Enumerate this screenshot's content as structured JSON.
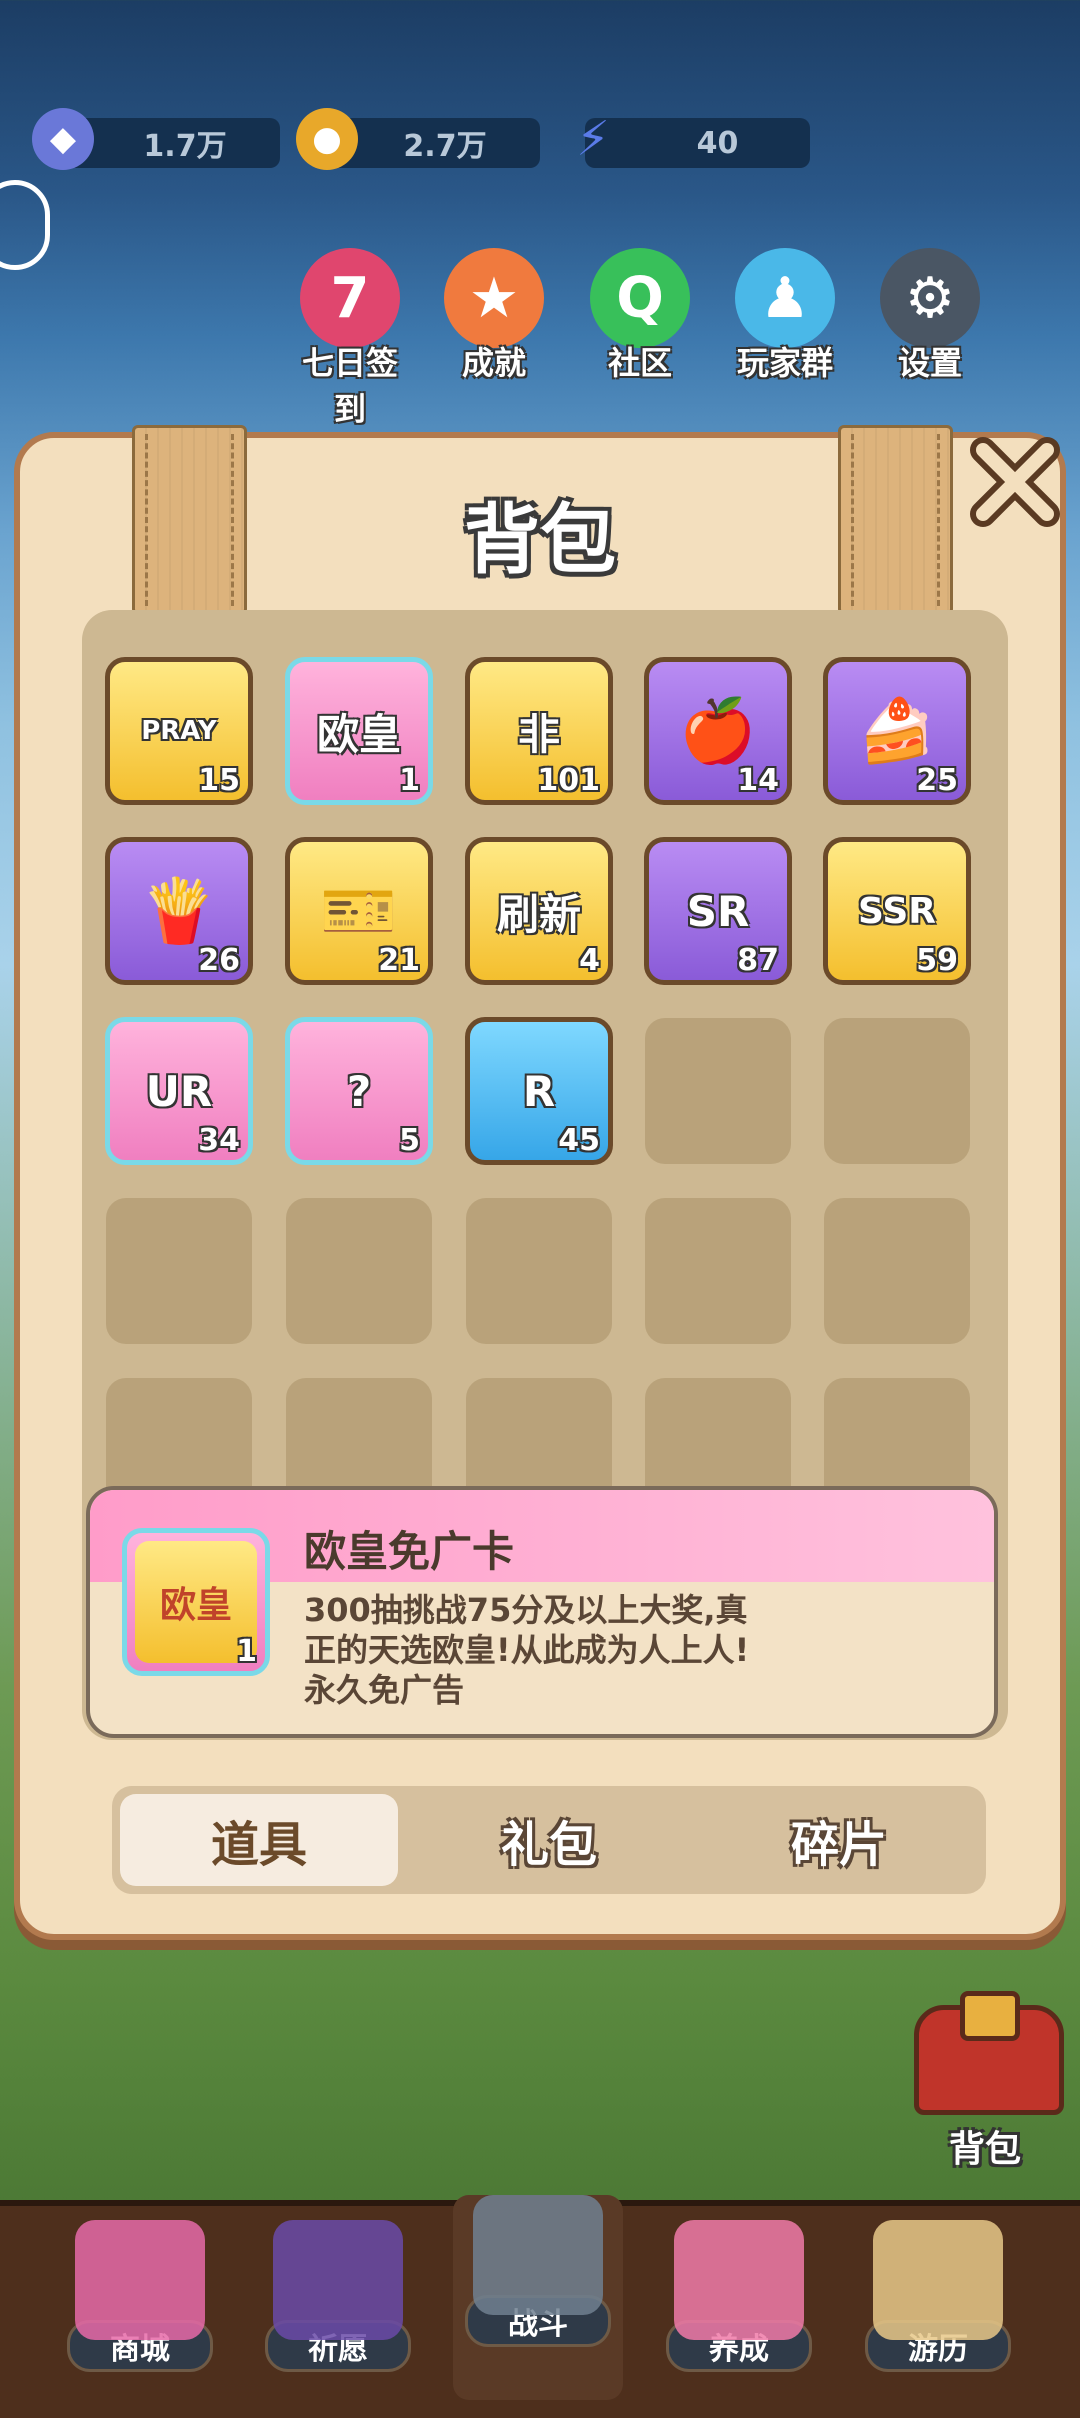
{
  "currency": {
    "gems": "1.7万",
    "coins": "2.7万",
    "energy": "40"
  },
  "top_menu": [
    {
      "label": "七日签到",
      "icon": "seven-day-icon",
      "glyph": "7",
      "color": "#e0466e"
    },
    {
      "label": "成就",
      "icon": "trophy-icon",
      "glyph": "★",
      "color": "#f07a3e"
    },
    {
      "label": "社区",
      "icon": "community-icon",
      "glyph": "Q",
      "color": "#38c05a"
    },
    {
      "label": "玩家群",
      "icon": "qq-penguin-icon",
      "glyph": "♟",
      "color": "#4ab8e8"
    },
    {
      "label": "设置",
      "icon": "gear-icon",
      "glyph": "⚙",
      "color": "#4a5664"
    }
  ],
  "panel": {
    "title": "背包"
  },
  "items": [
    {
      "icon": "pray-ticket-icon",
      "text": "PRAY",
      "count": "15",
      "frame": "gold"
    },
    {
      "icon": "ouhuang-card-icon",
      "text": "欧皇",
      "count": "1",
      "frame": "pink"
    },
    {
      "icon": "feiqiu-card-icon",
      "text": "非",
      "count": "101",
      "frame": "gold"
    },
    {
      "icon": "apple-icon",
      "text": "",
      "count": "14",
      "frame": "purple"
    },
    {
      "icon": "cake-icon",
      "text": "",
      "count": "25",
      "frame": "purple"
    },
    {
      "icon": "chips-icon",
      "text": "",
      "count": "26",
      "frame": "purple"
    },
    {
      "icon": "ghost-ticket-icon",
      "text": "",
      "count": "21",
      "frame": "gold"
    },
    {
      "icon": "refresh-card-icon",
      "text": "刷新",
      "count": "4",
      "frame": "gold"
    },
    {
      "icon": "sr-puzzle-icon",
      "text": "SR",
      "count": "87",
      "frame": "purple"
    },
    {
      "icon": "ssr-puzzle-icon",
      "text": "SSR",
      "count": "59",
      "frame": "gold"
    },
    {
      "icon": "ur-puzzle-icon",
      "text": "UR",
      "count": "34",
      "frame": "pink"
    },
    {
      "icon": "mystery-bag-icon",
      "text": "?",
      "count": "5",
      "frame": "pink"
    },
    {
      "icon": "r-puzzle-icon",
      "text": "R",
      "count": "45",
      "frame": "blue"
    }
  ],
  "detail": {
    "name": "欧皇免广卡",
    "desc": "300抽挑战75分及以上大奖,真正的天选欧皇!从此成为人上人!永久免广告",
    "icon_text": "欧皇",
    "count": "1"
  },
  "tabs": [
    {
      "label": "道具",
      "active": true
    },
    {
      "label": "礼包",
      "active": false
    },
    {
      "label": "碎片",
      "active": false
    }
  ],
  "bag_button": {
    "label": "背包"
  },
  "bottom_nav": [
    {
      "label": "商城",
      "icon": "shop-icon"
    },
    {
      "label": "祈愿",
      "icon": "wish-card-icon"
    },
    {
      "label": "战斗",
      "icon": "crossed-swords-icon"
    },
    {
      "label": "养成",
      "icon": "paw-icon"
    },
    {
      "label": "游历",
      "icon": "map-icon"
    }
  ]
}
